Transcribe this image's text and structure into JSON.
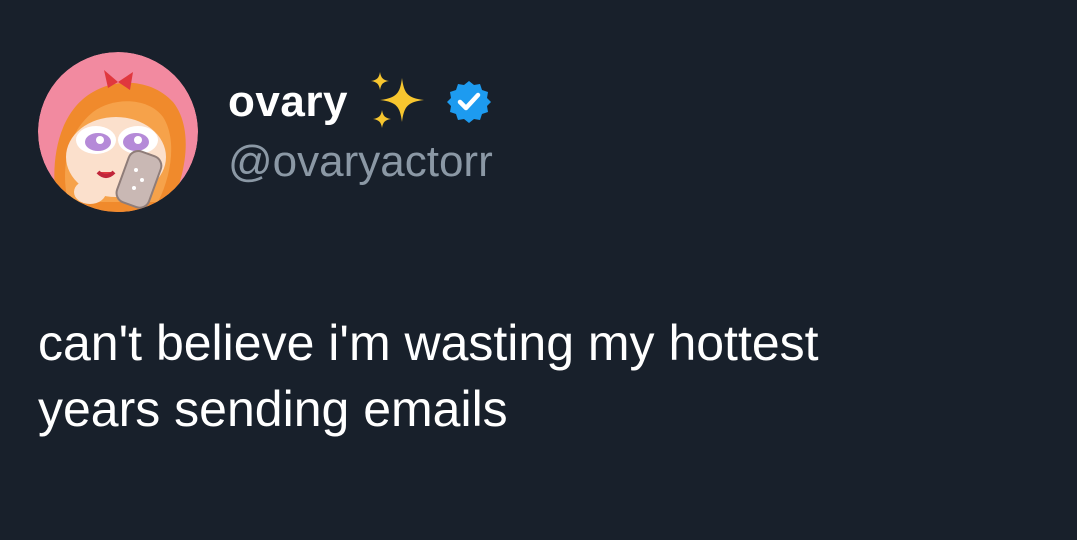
{
  "tweet": {
    "author": {
      "display_name": "ovary",
      "handle": "@ovaryactorr",
      "name_emoji": "sparkles-icon",
      "verified_badge": "verified-badge-icon",
      "avatar": "avatar-cartoon-girl-on-phone"
    },
    "text_line_1": "can't believe i'm wasting my hottest",
    "text_line_2": "years sending emails"
  },
  "colors": {
    "background": "#18202b",
    "name_text": "#ffffff",
    "handle_text": "#8b98a5",
    "body_text": "#ffffff",
    "verified_blue": "#1d9bf0",
    "sparkle_gold": "#f7c62f",
    "avatar_pink": "#f28aa0"
  }
}
